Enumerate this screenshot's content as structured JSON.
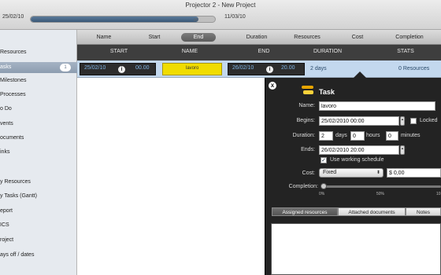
{
  "window": {
    "title": "Projector 2 - New Project",
    "start_date": "25/02/10",
    "end_date": "11/03/10",
    "timeline_progress": 0.91,
    "timeline_tick": "20"
  },
  "sidebar": {
    "items": [
      {
        "label": "Resources"
      },
      {
        "label": "asks",
        "badge": "1",
        "selected": true
      },
      {
        "label": "Milestones"
      },
      {
        "label": "Processes"
      },
      {
        "label": "o Do"
      },
      {
        "label": "vents"
      },
      {
        "label": "ocuments"
      },
      {
        "label": "inks"
      },
      {
        "label": "y Resources"
      },
      {
        "label": "y Tasks (Gantt)"
      },
      {
        "label": "eport"
      },
      {
        "label": "ICS"
      },
      {
        "label": "roject"
      },
      {
        "label": "ays off / dates"
      }
    ]
  },
  "tabs": [
    "Name",
    "Start",
    "End",
    "Duration",
    "Resources",
    "Cost",
    "Completion"
  ],
  "active_tab": "End",
  "columns": [
    "START",
    "NAME",
    "END",
    "DURATION",
    "STATS"
  ],
  "task_row": {
    "start_date": "25/02/10",
    "start_time": "00.00",
    "name": "lavoro",
    "end_date": "26/02/10",
    "end_time": "20.00",
    "duration": "2 days",
    "stats": "0 Resources"
  },
  "task_popover": {
    "title": "Task",
    "close_glyph": "x",
    "name_label": "Name:",
    "name_value": "lavoro",
    "begins_label": "Begins:",
    "begins_value": "25/02/2010 00:00",
    "locked_label": "Locked",
    "duration_label": "Duration:",
    "duration_days": "2",
    "days_label": "days",
    "duration_hours": "0",
    "hours_label": "hours",
    "duration_minutes": "0",
    "minutes_label": "minutes",
    "ends_label": "Ends:",
    "ends_value": "26/02/2010 20:00",
    "working_schedule_label": "Use working schedule",
    "working_schedule_checked": true,
    "cost_label": "Cost:",
    "cost_type": "Fixed",
    "cost_value": "$ 0,00",
    "completion_label": "Completion:",
    "completion_value": 0,
    "ticks": [
      "0%",
      "50%",
      "10"
    ],
    "tabs": [
      "Assigned resources",
      "Attached documents",
      "Notes"
    ],
    "active_tab": "Assigned resources"
  },
  "colors": {
    "accent": "#3b5978",
    "row_highlight": "#c3d8ee",
    "name_cell": "#f0dc00",
    "popover_bg": "#232323"
  },
  "icons": {
    "info": "info-icon",
    "close": "close-icon",
    "task": "task-icon",
    "stepper": "stepper-icon",
    "dropdown": "chevron-updown-icon"
  }
}
